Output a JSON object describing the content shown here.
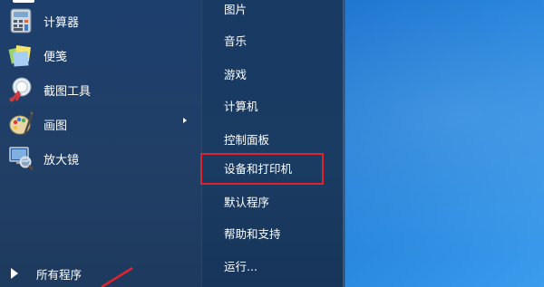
{
  "colors": {
    "highlight_border": "#e0232b",
    "menu_text": "#ffffff",
    "desktop_blue": "#1e6fc4"
  },
  "start_menu": {
    "programs": [
      {
        "label": "计算器",
        "icon": "calculator-icon"
      },
      {
        "label": "便笺",
        "icon": "sticky-notes-icon"
      },
      {
        "label": "截图工具",
        "icon": "snipping-tool-icon"
      },
      {
        "label": "画图",
        "icon": "paint-icon"
      },
      {
        "label": "放大镜",
        "icon": "magnifier-icon"
      }
    ],
    "all_programs_label": "所有程序",
    "places": [
      {
        "label": "图片"
      },
      {
        "label": "音乐"
      },
      {
        "label": "游戏"
      },
      {
        "label": "计算机"
      },
      {
        "label": "控制面板"
      },
      {
        "label": "设备和打印机",
        "highlighted": true
      },
      {
        "label": "默认程序"
      },
      {
        "label": "帮助和支持"
      },
      {
        "label": "运行..."
      }
    ]
  }
}
